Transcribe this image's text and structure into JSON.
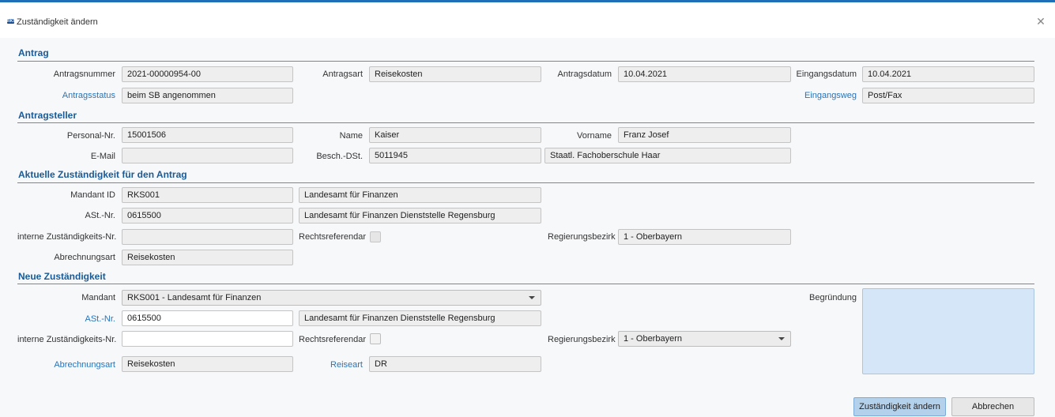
{
  "window": {
    "title": "Zuständigkeit ändern",
    "icon_text": "RKS",
    "close_icon": "close-icon"
  },
  "antrag": {
    "title": "Antrag",
    "antragsnummer_label": "Antragsnummer",
    "antragsnummer": "2021-00000954-00",
    "antragsart_label": "Antragsart",
    "antragsart": "Reisekosten",
    "antragsdatum_label": "Antragsdatum",
    "antragsdatum": "10.04.2021",
    "eingangsdatum_label": "Eingangsdatum",
    "eingangsdatum": "10.04.2021",
    "antragsstatus_label": "Antragsstatus",
    "antragsstatus": "beim SB angenommen",
    "eingangsweg_label": "Eingangsweg",
    "eingangsweg": "Post/Fax"
  },
  "antragsteller": {
    "title": "Antragsteller",
    "personal_nr_label": "Personal-Nr.",
    "personal_nr": "15001506",
    "name_label": "Name",
    "name": "Kaiser",
    "vorname_label": "Vorname",
    "vorname": "Franz Josef",
    "email_label": "E-Mail",
    "email": "",
    "besch_dst_label": "Besch.-DSt.",
    "besch_dst": "5011945",
    "dienststelle": "Staatl. Fachoberschule Haar"
  },
  "aktuell": {
    "title": "Aktuelle Zuständigkeit für den Antrag",
    "mandant_id_label": "Mandant ID",
    "mandant_id": "RKS001",
    "mandant_name": "Landesamt für Finanzen",
    "ast_nr_label": "ASt.-Nr.",
    "ast_nr": "0615500",
    "ast_name": "Landesamt für Finanzen Dienststelle Regensburg",
    "interne_label": "interne Zuständigkeits-Nr.",
    "interne": "",
    "rechtsreferendar_label": "Rechtsreferendar",
    "regierungsbezirk_label": "Regierungsbezirk",
    "regierungsbezirk": "1 - Oberbayern",
    "abrechnungsart_label": "Abrechnungsart",
    "abrechnungsart": "Reisekosten"
  },
  "neu": {
    "title": "Neue Zuständigkeit",
    "mandant_label": "Mandant",
    "mandant": "RKS001 - Landesamt für Finanzen",
    "ast_nr_label": "ASt.-Nr.",
    "ast_nr": "0615500",
    "ast_name": "Landesamt für Finanzen Dienststelle Regensburg",
    "interne_label": "interne Zuständigkeits-Nr.",
    "interne": "",
    "rechtsreferendar_label": "Rechtsreferendar",
    "regierungsbezirk_label": "Regierungsbezirk",
    "regierungsbezirk": "1 - Oberbayern",
    "abrechnungsart_label": "Abrechnungsart",
    "abrechnungsart": "Reisekosten",
    "reiseart_label": "Reiseart",
    "reiseart": "DR",
    "begruendung_label": "Begründung",
    "begruendung": ""
  },
  "buttons": {
    "submit": "Zuständigkeit ändern",
    "cancel": "Abbrechen"
  },
  "colors": {
    "accent": "#1e6fb8",
    "section": "#1a5a96",
    "link": "#2a73b8",
    "primary_button": "#b4d1ec"
  }
}
